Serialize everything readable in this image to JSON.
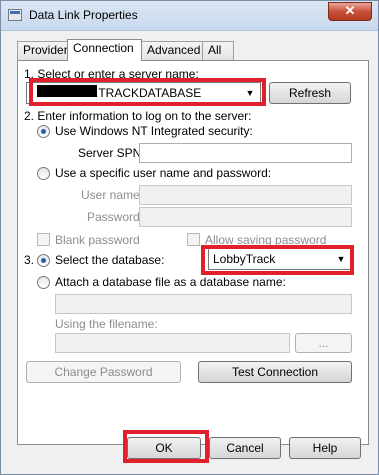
{
  "window": {
    "title": "Data Link Properties",
    "close_glyph": "✕"
  },
  "tabs": [
    {
      "label": "Provider",
      "active": false
    },
    {
      "label": "Connection",
      "active": true
    },
    {
      "label": "Advanced",
      "active": false
    },
    {
      "label": "All",
      "active": false
    }
  ],
  "connection": {
    "step1_label": "1. Select or enter a server name:",
    "server_name": ".TRACKDATABASE",
    "refresh_label": "Refresh",
    "step2_label": "2. Enter information to log on to the server:",
    "auth_windows_label": "Use Windows NT Integrated security:",
    "server_spn_label": "Server SPN:",
    "server_spn_value": "",
    "auth_specific_label": "Use a specific user name and password:",
    "user_name_label": "User name:",
    "user_name_value": "",
    "password_label": "Password:",
    "password_value": "",
    "blank_password_label": "Blank password",
    "allow_saving_label": "Allow saving password",
    "step3_prefix": "3.",
    "select_db_label": "Select the database:",
    "database_value": "LobbyTrack",
    "attach_db_label": "Attach a database file as a database name:",
    "attach_value": "",
    "using_filename_label": "Using the filename:",
    "filename_value": "",
    "browse_label": "...",
    "change_password_label": "Change Password",
    "test_connection_label": "Test Connection"
  },
  "footer": {
    "ok_label": "OK",
    "cancel_label": "Cancel",
    "help_label": "Help"
  },
  "highlight_color": "#e0202a"
}
